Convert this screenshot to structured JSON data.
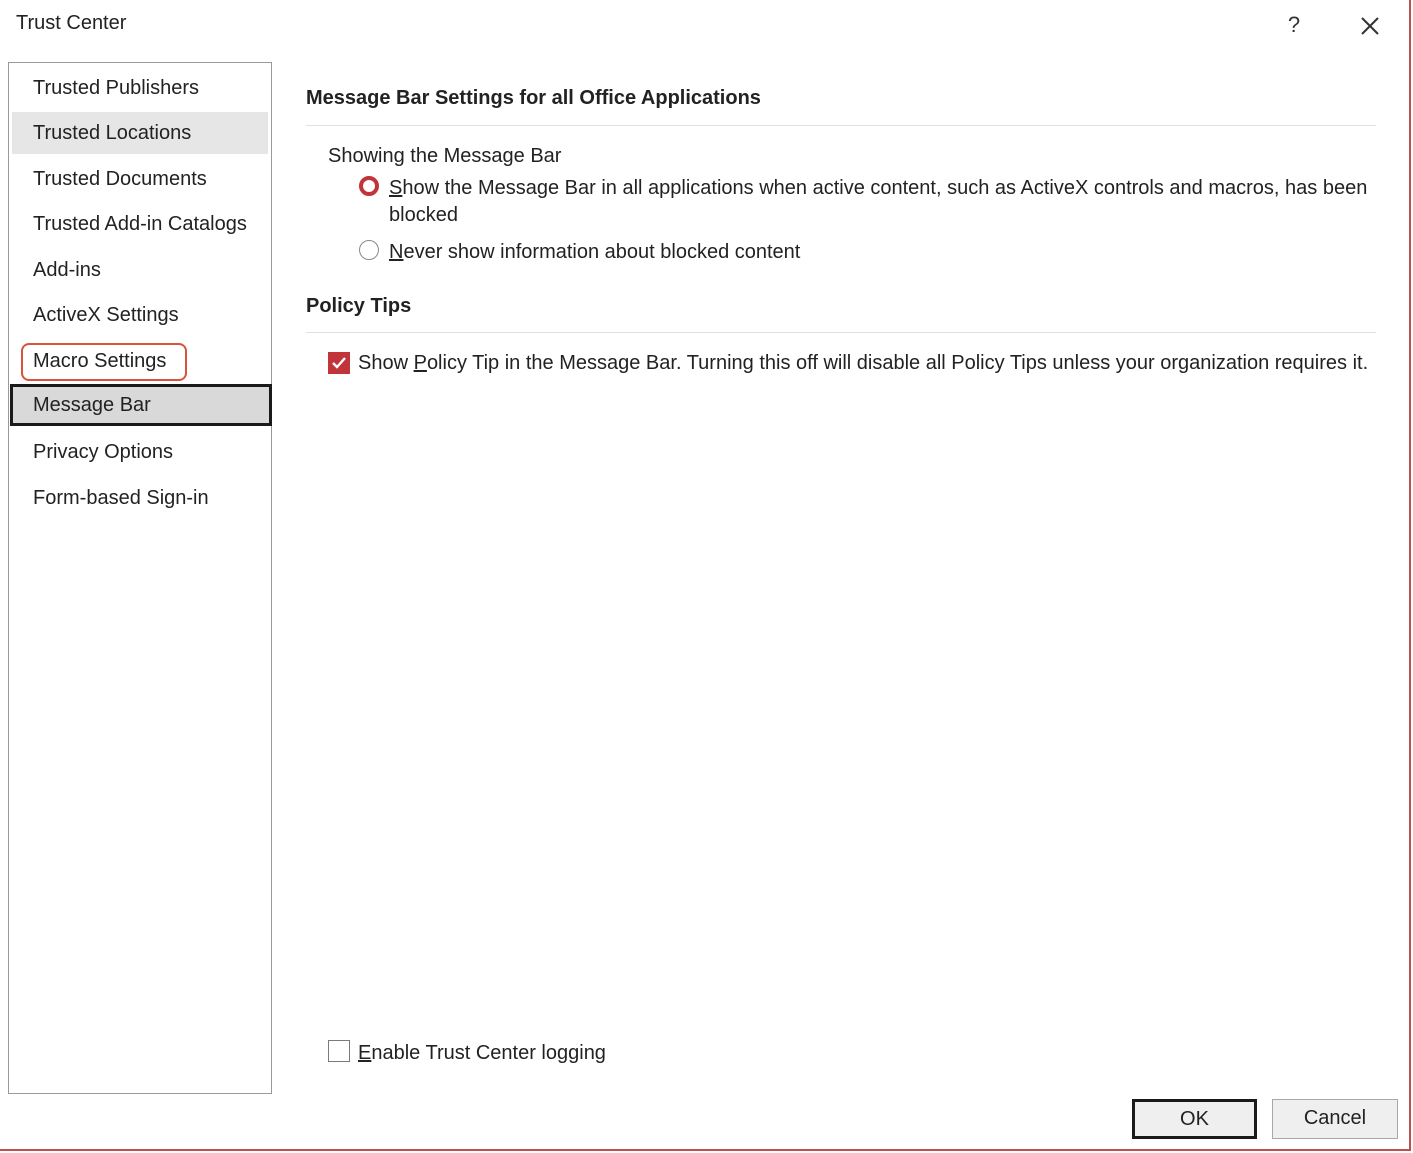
{
  "window": {
    "title": "Trust Center",
    "help_label": "?",
    "close_icon": "close-icon"
  },
  "sidebar": {
    "items": [
      {
        "label": "Trusted Publishers"
      },
      {
        "label": "Trusted Locations"
      },
      {
        "label": "Trusted Documents"
      },
      {
        "label": "Trusted Add-in Catalogs"
      },
      {
        "label": "Add-ins"
      },
      {
        "label": "ActiveX Settings"
      },
      {
        "label": "Macro Settings"
      },
      {
        "label": "Message Bar"
      },
      {
        "label": "Privacy Options"
      },
      {
        "label": "Form-based Sign-in"
      }
    ],
    "selected": "Message Bar",
    "highlighted": "Macro Settings"
  },
  "main": {
    "message_bar_section": {
      "heading": "Message Bar Settings for all Office Applications",
      "group_label": "Showing the Message Bar",
      "option_show_first": "S",
      "option_show_rest": "how the Message Bar in all applications when active content, such as ActiveX controls and macros, has been",
      "option_show_wrap": "blocked",
      "option_show_selected": true,
      "option_never_first": "N",
      "option_never_rest": "ever show information about blocked content",
      "option_never_selected": false
    },
    "policy_tips_section": {
      "heading": "Policy Tips",
      "checkbox_pre": "Show ",
      "checkbox_accel": "P",
      "checkbox_post": "olicy Tip in the Message Bar. Turning this off will disable all Policy Tips unless your organization requires it.",
      "checked": true
    },
    "logging": {
      "label_first": "E",
      "label_rest": "nable Trust Center logging",
      "checked": false
    }
  },
  "footer": {
    "ok_label": "OK",
    "cancel_label": "Cancel"
  },
  "colors": {
    "accent": "#c0343a",
    "highlight_outline": "#d9533a",
    "window_border": "#c0504d"
  }
}
